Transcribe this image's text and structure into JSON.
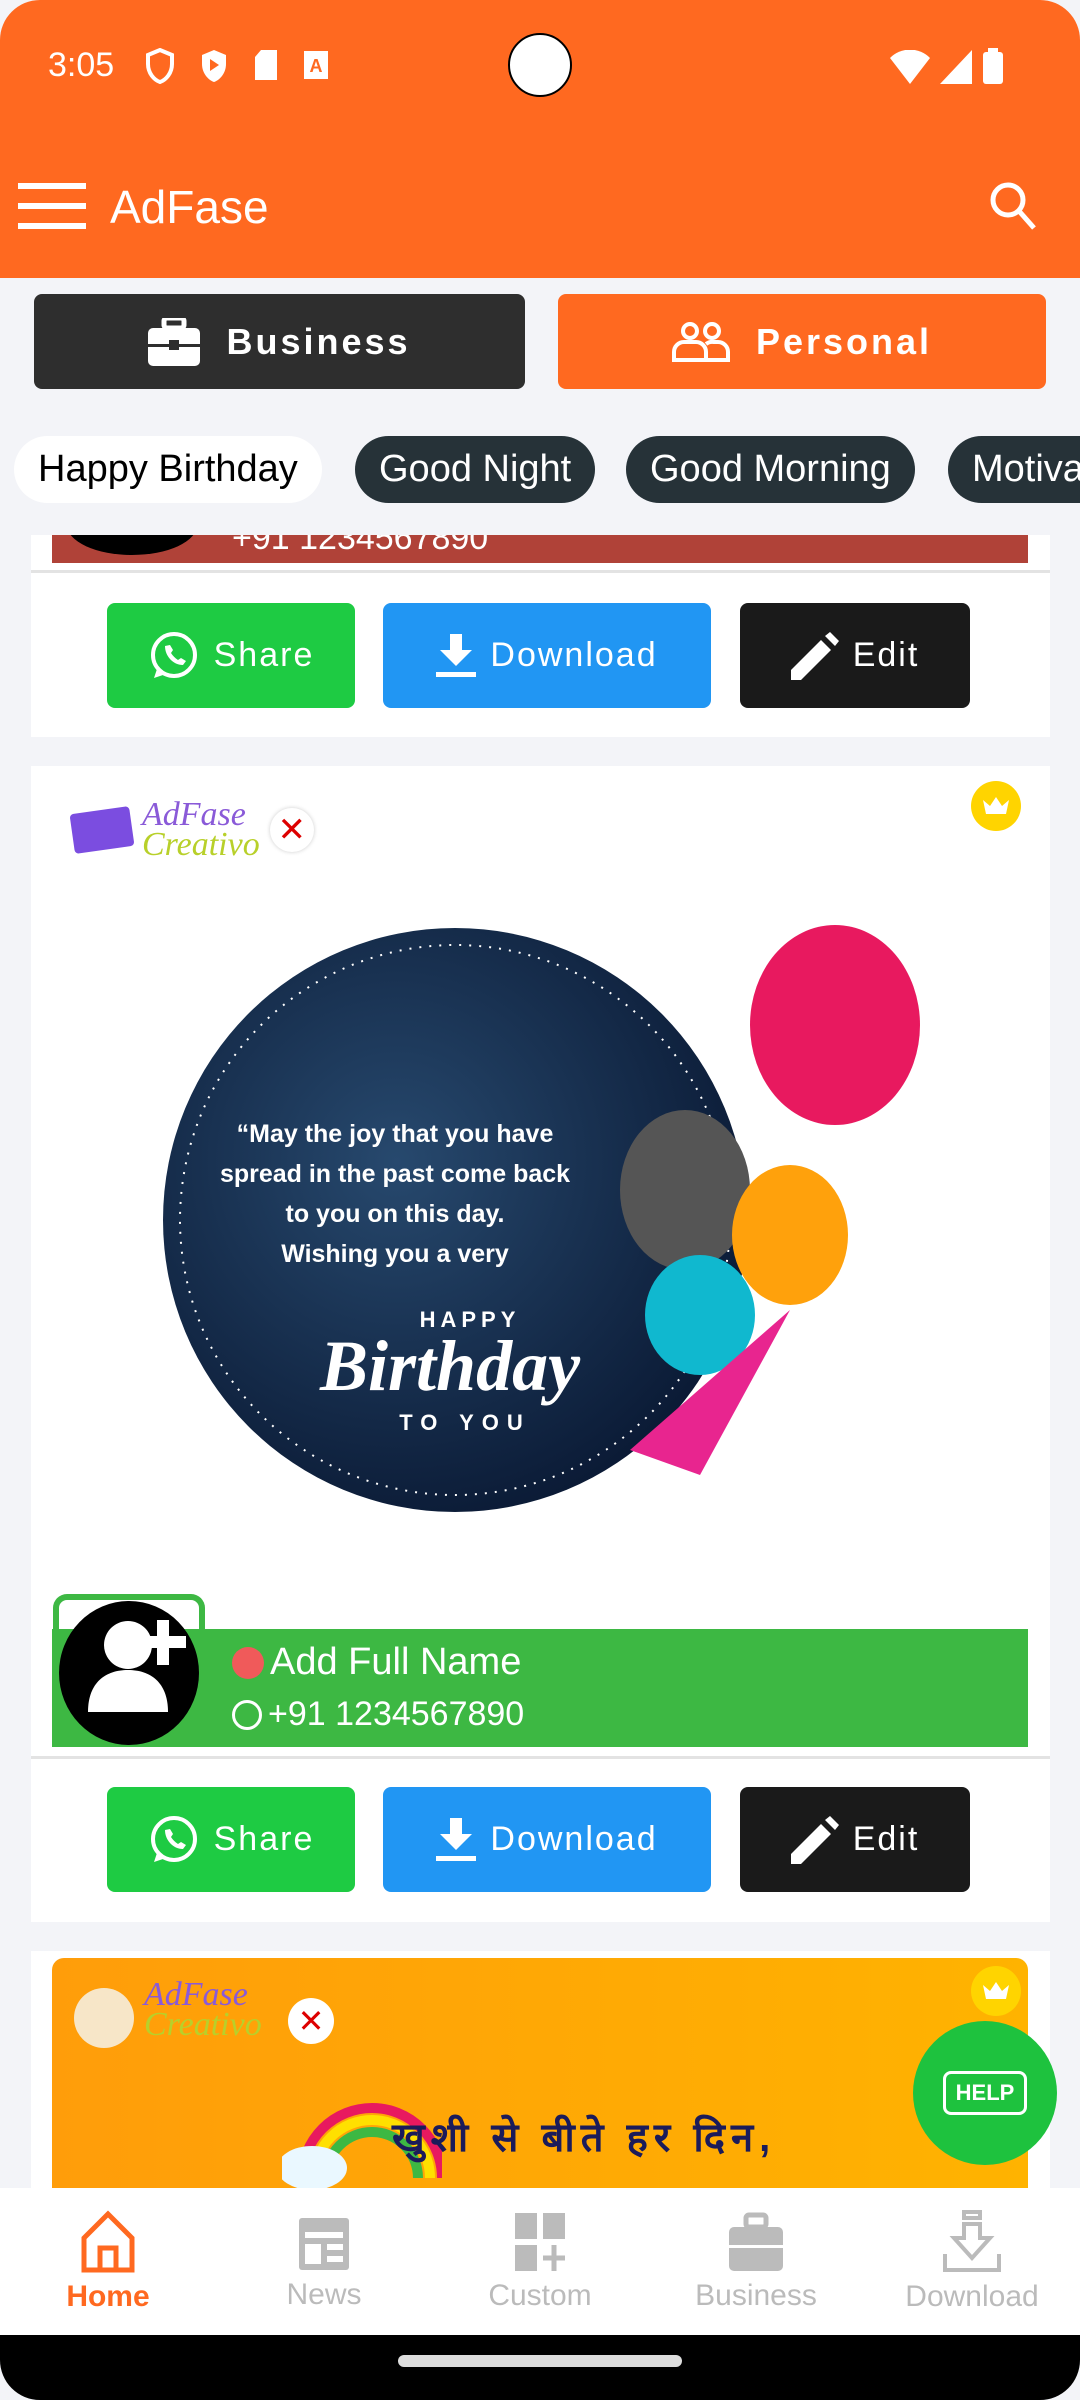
{
  "status_bar": {
    "time": "3:05"
  },
  "app_bar": {
    "title": "AdFase",
    "menu_icon": "hamburger-icon",
    "search_icon": "search-icon"
  },
  "segments": [
    {
      "label": "Business",
      "icon": "briefcase-icon",
      "selected": false
    },
    {
      "label": "Personal",
      "icon": "people-icon",
      "selected": true
    }
  ],
  "chips": [
    {
      "label": "Happy Birthday",
      "selected": true
    },
    {
      "label": "Good Night"
    },
    {
      "label": "Good Morning"
    },
    {
      "label": "Motiva"
    }
  ],
  "colors": {
    "accent": "#ff6920",
    "share": "#1ecb43",
    "download": "#2196f3",
    "edit": "#1a1a1a",
    "name_bar": "#3db843"
  },
  "actions": {
    "share": "Share",
    "download": "Download",
    "edit": "Edit"
  },
  "card1": {
    "phone": "+91 1234567890"
  },
  "card2": {
    "logo_top": "AdFase",
    "logo_bottom": "Creativo",
    "quote": [
      "“May the joy that you have",
      "spread in the past come back",
      "to you on this day.",
      "Wishing you a very"
    ],
    "happy": "HAPPY",
    "birthday": "Birthday",
    "to_you": "TO YOU",
    "name": "Add Full Name",
    "phone": "+91 1234567890"
  },
  "card3": {
    "logo_top": "AdFase",
    "logo_bottom": "Creativo",
    "hindi": "खुशी से बीते हर दिन,"
  },
  "help": {
    "label": "HELP"
  },
  "bottom_nav": [
    {
      "label": "Home",
      "icon": "home-icon",
      "active": true
    },
    {
      "label": "News",
      "icon": "news-icon"
    },
    {
      "label": "Custom",
      "icon": "custom-icon"
    },
    {
      "label": "Business",
      "icon": "briefcase-icon"
    },
    {
      "label": "Download",
      "icon": "download-tray-icon"
    }
  ]
}
